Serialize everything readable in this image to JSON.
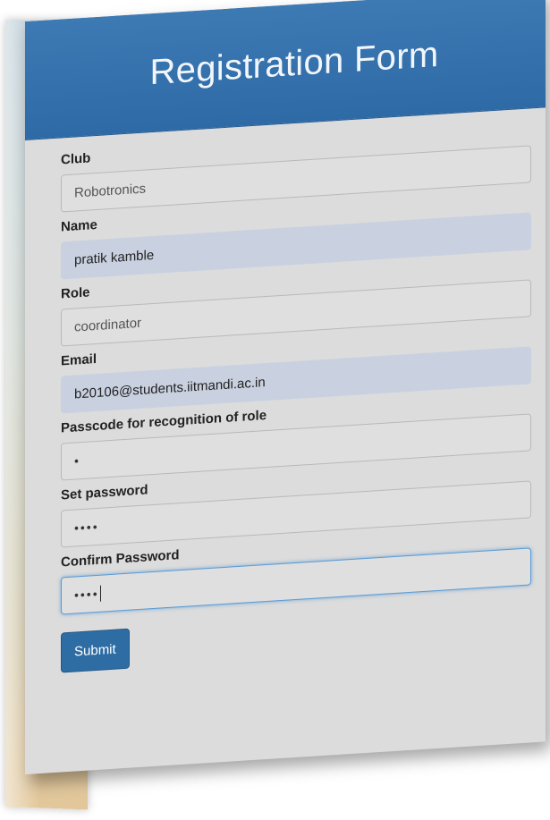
{
  "form": {
    "title": "Registration Form",
    "fields": {
      "club": {
        "label": "Club",
        "value": "Robotronics"
      },
      "name": {
        "label": "Name",
        "value": "pratik kamble"
      },
      "role": {
        "label": "Role",
        "value": "coordinator"
      },
      "email": {
        "label": "Email",
        "value": "b20106@students.iitmandi.ac.in"
      },
      "passcode": {
        "label": "Passcode for recognition of role",
        "value": "•"
      },
      "set_password": {
        "label": "Set password",
        "value": "••••"
      },
      "confirm_password": {
        "label": "Confirm Password",
        "value": "••••"
      }
    },
    "submit_label": "Submit"
  },
  "colors": {
    "header": "#2e6aa6",
    "card": "#dcdcdc",
    "autofill": "#c9d1e0",
    "button": "#2e6da4"
  }
}
